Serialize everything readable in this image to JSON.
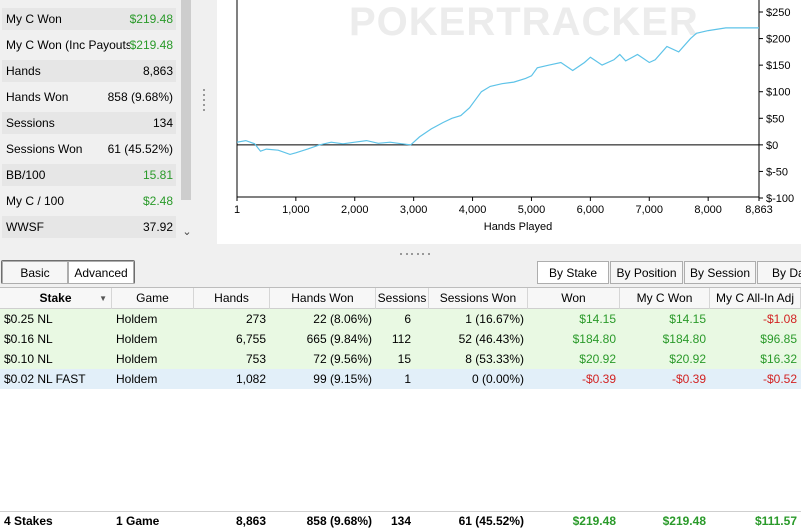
{
  "stats": {
    "rows": [
      {
        "label": "My C Won",
        "value": "$219.48",
        "tone": "green"
      },
      {
        "label": "My C Won (Inc Payouts)",
        "value": "$219.48",
        "tone": "green"
      },
      {
        "label": "Hands",
        "value": "8,863",
        "tone": ""
      },
      {
        "label": "Hands Won",
        "value": "858 (9.68%)",
        "tone": ""
      },
      {
        "label": "Sessions",
        "value": "134",
        "tone": ""
      },
      {
        "label": "Sessions Won",
        "value": "61 (45.52%)",
        "tone": ""
      },
      {
        "label": "BB/100",
        "value": "15.81",
        "tone": "green"
      },
      {
        "label": "My C / 100",
        "value": "$2.48",
        "tone": "green"
      },
      {
        "label": "WWSF",
        "value": "37.92",
        "tone": ""
      }
    ],
    "scroll_down_icon": "chevron-down-icon"
  },
  "chart_data": {
    "type": "line",
    "watermark": "POKERTRACKER",
    "xlabel": "Hands Played",
    "ylabel": "",
    "xlim": [
      1,
      8863
    ],
    "ylim": [
      -100,
      250
    ],
    "x_ticks": [
      "1",
      "1,000",
      "2,000",
      "3,000",
      "4,000",
      "5,000",
      "6,000",
      "7,000",
      "8,000",
      "8,863"
    ],
    "x_tick_values": [
      1,
      1000,
      2000,
      3000,
      4000,
      5000,
      6000,
      7000,
      8000,
      8863
    ],
    "y_ticks": [
      "$250",
      "$200",
      "$150",
      "$100",
      "$50",
      "$0",
      "$-50",
      "$-100"
    ],
    "y_tick_values": [
      250,
      200,
      150,
      100,
      50,
      0,
      -50,
      -100
    ],
    "series": [
      {
        "color": "#5ec3e8",
        "x": [
          1,
          150,
          300,
          400,
          500,
          700,
          900,
          1000,
          1200,
          1400,
          1600,
          1800,
          2000,
          2200,
          2400,
          2600,
          2800,
          2950,
          3100,
          3300,
          3500,
          3650,
          3800,
          3950,
          4050,
          4150,
          4300,
          4500,
          4700,
          4900,
          5000,
          5100,
          5300,
          5500,
          5700,
          5900,
          6000,
          6200,
          6400,
          6500,
          6600,
          6800,
          7000,
          7100,
          7300,
          7500,
          7700,
          7800,
          8000,
          8300,
          8600,
          8863
        ],
        "y": [
          5,
          8,
          2,
          -12,
          -8,
          -10,
          -18,
          -15,
          -8,
          0,
          5,
          2,
          5,
          8,
          3,
          5,
          2,
          0,
          15,
          30,
          42,
          50,
          55,
          70,
          85,
          100,
          110,
          115,
          118,
          125,
          130,
          145,
          150,
          155,
          140,
          155,
          165,
          150,
          160,
          170,
          158,
          170,
          155,
          160,
          185,
          175,
          200,
          210,
          215,
          220,
          220,
          220
        ]
      }
    ]
  },
  "tabs_left": [
    {
      "label": "Basic",
      "selected": false
    },
    {
      "label": "Advanced",
      "selected": true
    }
  ],
  "tabs_right": [
    {
      "label": "By Stake",
      "selected": true
    },
    {
      "label": "By Position",
      "selected": false
    },
    {
      "label": "By Session",
      "selected": false
    },
    {
      "label": "By Da",
      "selected": false
    }
  ],
  "table": {
    "columns": [
      "Stake",
      "Game",
      "Hands",
      "Hands Won",
      "Sessions",
      "Sessions Won",
      "Won",
      "My C Won",
      "My C All-In Adj"
    ],
    "sorted_column": "Stake",
    "rows": [
      {
        "cells": [
          "$0.25 NL",
          "Holdem",
          "273",
          "22 (8.06%)",
          "6",
          "1 (16.67%)",
          "$14.15",
          "$14.15",
          "-$1.08"
        ],
        "tones": [
          "",
          "",
          "",
          "",
          "",
          "",
          "green",
          "green",
          "red"
        ],
        "bg": "green"
      },
      {
        "cells": [
          "$0.16 NL",
          "Holdem",
          "6,755",
          "665 (9.84%)",
          "112",
          "52 (46.43%)",
          "$184.80",
          "$184.80",
          "$96.85"
        ],
        "tones": [
          "",
          "",
          "",
          "",
          "",
          "",
          "green",
          "green",
          "green"
        ],
        "bg": "green"
      },
      {
        "cells": [
          "$0.10 NL",
          "Holdem",
          "753",
          "72 (9.56%)",
          "15",
          "8 (53.33%)",
          "$20.92",
          "$20.92",
          "$16.32"
        ],
        "tones": [
          "",
          "",
          "",
          "",
          "",
          "",
          "green",
          "green",
          "green"
        ],
        "bg": "green"
      },
      {
        "cells": [
          "$0.02 NL FAST",
          "Holdem",
          "1,082",
          "99 (9.15%)",
          "1",
          "0 (0.00%)",
          "-$0.39",
          "-$0.39",
          "-$0.52"
        ],
        "tones": [
          "",
          "",
          "",
          "",
          "",
          "",
          "red",
          "red",
          "red"
        ],
        "bg": "blue"
      }
    ],
    "footer": {
      "cells": [
        "4 Stakes",
        "1 Game",
        "8,863",
        "858 (9.68%)",
        "134",
        "61 (45.52%)",
        "$219.48",
        "$219.48",
        "$111.57"
      ],
      "tones": [
        "",
        "",
        "",
        "",
        "",
        "",
        "green",
        "green",
        "green"
      ]
    }
  }
}
